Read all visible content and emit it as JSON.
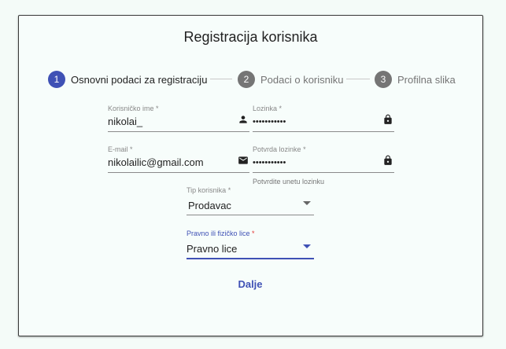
{
  "title": "Registracija korisnika",
  "stepper": {
    "steps": [
      {
        "number": "1",
        "label": "Osnovni podaci za registraciju",
        "state": "active"
      },
      {
        "number": "2",
        "label": "Podaci o korisniku",
        "state": "inactive"
      },
      {
        "number": "3",
        "label": "Profilna slika",
        "state": "inactive"
      }
    ]
  },
  "form": {
    "username": {
      "label": "Korisničko ime",
      "required": "*",
      "value": "nikolai_",
      "icon": "person-icon"
    },
    "password": {
      "label": "Lozinka",
      "required": "*",
      "value": "•••••••••••",
      "icon": "lock-icon"
    },
    "email": {
      "label": "E-mail",
      "required": "*",
      "value": "nikolailic@gmail.com",
      "icon": "mail-icon"
    },
    "confirm_password": {
      "label": "Potvrda lozinke",
      "required": "*",
      "value": "•••••••••••",
      "icon": "lock-icon",
      "hint": "Potvrdite unetu lozinku"
    },
    "user_type": {
      "label": "Tip korisnika",
      "required": "*",
      "value": "Prodavac"
    },
    "entity_type": {
      "label": "Pravno ili fizičko lice",
      "required": "*",
      "value": "Pravno lice"
    }
  },
  "next_button": "Dalje",
  "colors": {
    "accent": "#3f51b5",
    "inactive_step": "#757575",
    "required_focused": "#e53935"
  }
}
